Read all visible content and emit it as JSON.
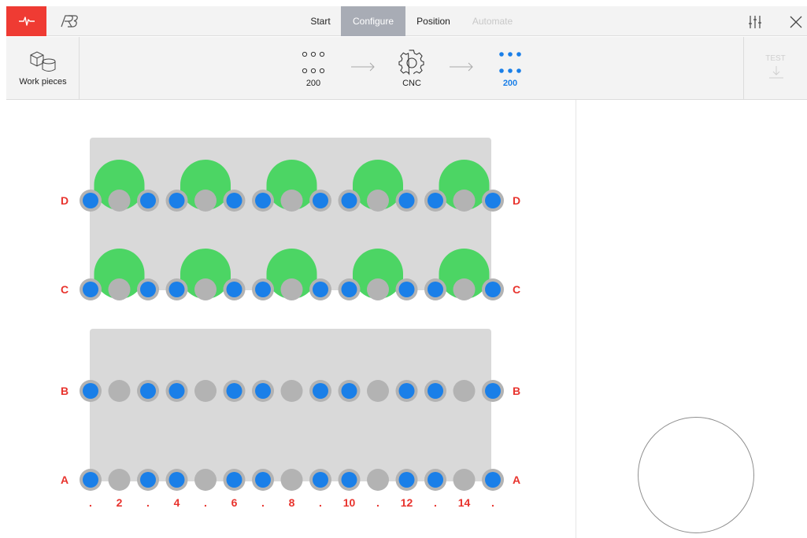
{
  "topbar": {
    "pulse_icon": "pulse-icon",
    "logo_icon": "robot-logo-icon",
    "tabs": [
      {
        "label": "Start",
        "state": "normal"
      },
      {
        "label": "Configure",
        "state": "active"
      },
      {
        "label": "Position",
        "state": "normal"
      },
      {
        "label": "Automate",
        "state": "disabled"
      }
    ],
    "settings_icon": "sliders-icon",
    "close_icon": "close-icon"
  },
  "toolbar": {
    "workpieces_label": "Work pieces",
    "steps": [
      {
        "label": "200",
        "icon": "grid-dots-outline-icon",
        "active": false
      },
      {
        "label": "CNC",
        "icon": "gear-icon",
        "active": false
      },
      {
        "label": "200",
        "icon": "grid-dots-filled-icon",
        "active": true
      }
    ],
    "test_label": "TEST",
    "test_icon": "download-arrow-icon"
  },
  "grid": {
    "row_labels": [
      "D",
      "C",
      "B",
      "A"
    ],
    "column_labels": [
      ".",
      "2",
      ".",
      "4",
      ".",
      "6",
      ".",
      "8",
      ".",
      "10",
      ".",
      "12",
      ".",
      "14",
      "."
    ],
    "rows": [
      {
        "label": "D",
        "pins": [
          "blue",
          "gray",
          "blue",
          "blue",
          "gray",
          "blue",
          "blue",
          "gray",
          "blue",
          "blue",
          "gray",
          "blue",
          "blue",
          "gray",
          "blue"
        ],
        "workpieces": 5
      },
      {
        "label": "C",
        "pins": [
          "blue",
          "gray",
          "blue",
          "blue",
          "gray",
          "blue",
          "blue",
          "gray",
          "blue",
          "blue",
          "gray",
          "blue",
          "blue",
          "gray",
          "blue"
        ],
        "workpieces": 5
      },
      {
        "label": "B",
        "pins": [
          "blue",
          "gray",
          "blue",
          "blue",
          "gray",
          "blue",
          "blue",
          "gray",
          "blue",
          "blue",
          "gray",
          "blue",
          "blue",
          "gray",
          "blue"
        ],
        "workpieces": 0
      },
      {
        "label": "A",
        "pins": [
          "blue",
          "gray",
          "blue",
          "blue",
          "gray",
          "blue",
          "blue",
          "gray",
          "blue",
          "blue",
          "gray",
          "blue",
          "blue",
          "gray",
          "blue"
        ],
        "workpieces": 0
      }
    ],
    "colors": {
      "label": "#e8332d",
      "pin_blue": "#1a7fe8",
      "pin_gray": "#b3b3b3",
      "workpiece": "#4cd564",
      "plate": "#d9d9d9"
    }
  },
  "joystick_icon": "joystick-pad"
}
